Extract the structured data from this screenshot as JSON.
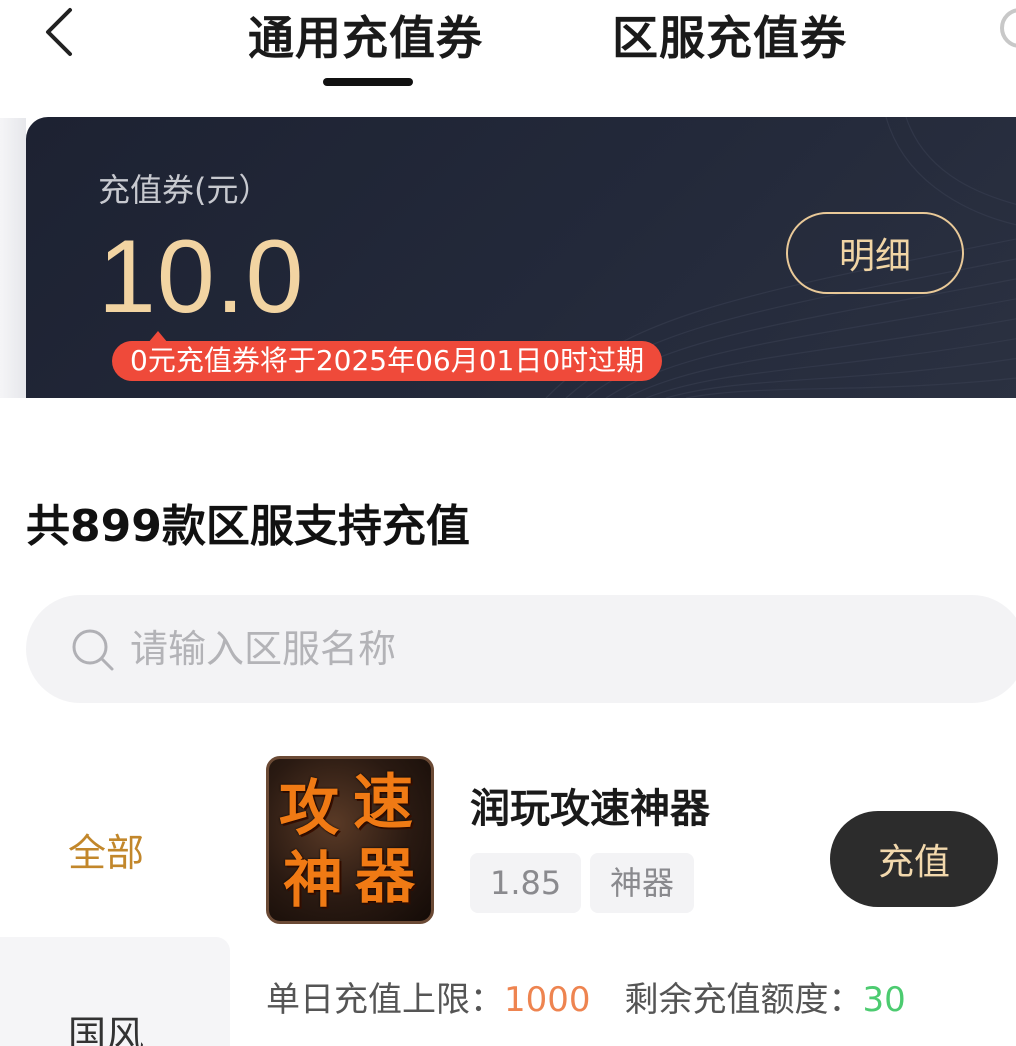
{
  "header": {
    "tabs": [
      {
        "label": "通用充值券",
        "active": true
      },
      {
        "label": "区服充值券",
        "active": false
      }
    ]
  },
  "voucher_card": {
    "label": "充值券(元）",
    "amount": "10.0",
    "detail_button": "明细",
    "expire_notice": "0元充值券将于2025年06月01日0时过期"
  },
  "server_section": {
    "heading": "共899款区服支持充值",
    "search_placeholder": "请输入区服名称"
  },
  "sidebar": {
    "items": [
      {
        "label": "全部",
        "active": true
      },
      {
        "label": "国风",
        "active": false
      }
    ]
  },
  "games": [
    {
      "name": "润玩攻速神器",
      "icon_text": [
        "攻",
        "速",
        "神",
        "器"
      ],
      "tags": [
        "1.85",
        "神器"
      ],
      "recharge_button": "充值",
      "daily_limit_label": "单日充值上限：",
      "daily_limit_value": "1000",
      "remaining_label": "剩余充值额度：",
      "remaining_value": "30"
    }
  ],
  "colors": {
    "accent_gold": "#f2d4a2",
    "sidebar_active": "#c2872b",
    "warning_red": "#ef4a3a",
    "limit_orange": "#ee8450",
    "remaining_green": "#4ccb70"
  },
  "icons": [
    "back-chevron-icon",
    "search-icon"
  ]
}
